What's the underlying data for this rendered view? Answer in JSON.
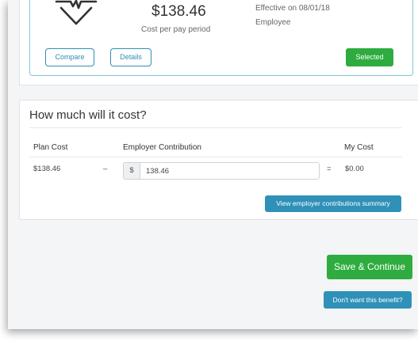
{
  "plan": {
    "price": "$138.46",
    "price_label": "Cost per pay period",
    "effective": "Effective on 08/01/18",
    "coverage": "Employee",
    "icon": "heartbeat-icon",
    "compare_label": "Compare",
    "details_label": "Details",
    "selected_label": "Selected"
  },
  "cost": {
    "title": "How much will it cost?",
    "headers": {
      "plan_cost": "Plan Cost",
      "employer_contribution": "Employer Contribution",
      "my_cost": "My Cost"
    },
    "row": {
      "plan_cost": "$138.46",
      "minus": "–",
      "currency": "$",
      "contribution_value": "138.46",
      "equals": "=",
      "my_cost": "$0.00"
    },
    "summary_button": "View employer contributions summary"
  },
  "actions": {
    "save_continue": "Save & Continue",
    "dont_want": "Don't want this benefit?"
  },
  "colors": {
    "primary_green": "#2eac3f",
    "primary_blue": "#2f91b8",
    "outline_blue": "#2f8fb3",
    "card_border": "#7fc6d6"
  }
}
